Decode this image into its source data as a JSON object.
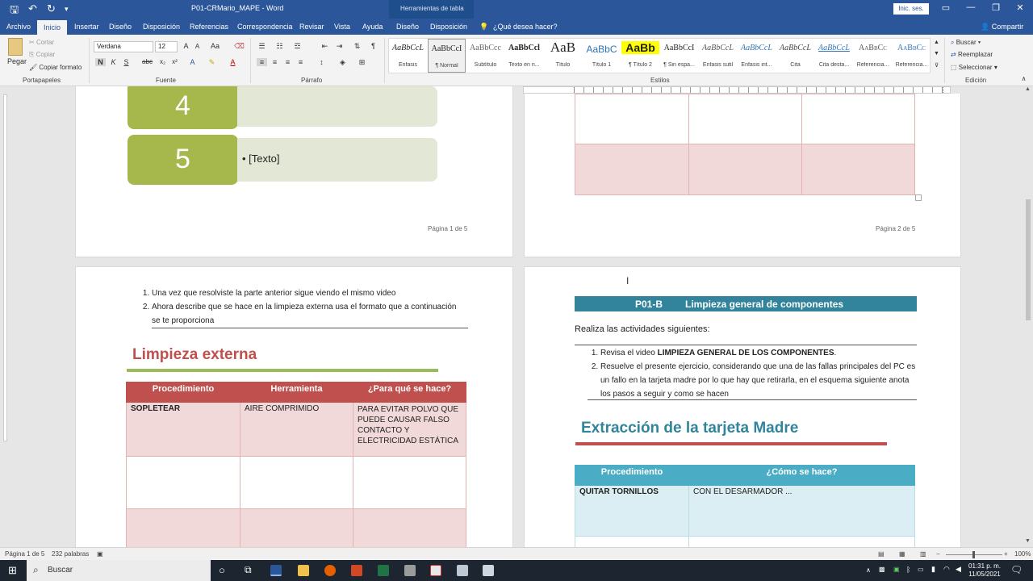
{
  "titlebar": {
    "doc_title": "P01-CRMario_MAPE  -  Word",
    "context_tools": "Herramientas de tabla",
    "login_label": "Inic. ses.",
    "share_label": "Compartir"
  },
  "tabs": [
    "Archivo",
    "Inicio",
    "Insertar",
    "Diseño",
    "Disposición",
    "Referencias",
    "Correspondencia",
    "Revisar",
    "Vista",
    "Ayuda",
    "Diseño",
    "Disposición"
  ],
  "tell_me": "¿Qué desea hacer?",
  "clipboard": {
    "paste": "Pegar",
    "cut": "Cortar",
    "copy": "Copiar",
    "format_painter": "Copiar formato",
    "group": "Portapapeles"
  },
  "font": {
    "name": "Verdana",
    "size": "12",
    "group": "Fuente"
  },
  "paragraph_group": "Párrafo",
  "styles": {
    "group": "Estilos",
    "items": [
      {
        "preview": "AaBbCcL",
        "name": "Énfasis"
      },
      {
        "preview": "AaBbCcI",
        "name": "¶ Normal"
      },
      {
        "preview": "AaBbCcc",
        "name": "Subtítulo"
      },
      {
        "preview": "AaBbCcl",
        "name": "Texto en n..."
      },
      {
        "preview": "AaB",
        "name": "Título"
      },
      {
        "preview": "AaBbC",
        "name": "Título 1"
      },
      {
        "preview": "AaBb",
        "name": "¶ Título 2"
      },
      {
        "preview": "AaBbCcI",
        "name": "¶ Sin espa..."
      },
      {
        "preview": "AaBbCcL",
        "name": "Énfasis sutil"
      },
      {
        "preview": "AaBbCcL",
        "name": "Énfasis int..."
      },
      {
        "preview": "AaBbCcL",
        "name": "Cita"
      },
      {
        "preview": "AaBbCcL",
        "name": "Cita desta..."
      },
      {
        "preview": "AaBbCc",
        "name": "Referencia..."
      },
      {
        "preview": "AaBbCc",
        "name": "Referencia..."
      }
    ]
  },
  "editing": {
    "find": "Buscar",
    "replace": "Reemplazar",
    "select": "Seleccionar",
    "group": "Edición"
  },
  "page1": {
    "box4": "4",
    "box5": "5",
    "box5_text": "• [Texto]",
    "page_label": "Página 1 de 5"
  },
  "page2": {
    "page_label": "Página 2 de 5"
  },
  "page3": {
    "list": [
      "Una vez que resolviste la parte anterior sigue viendo el mismo video",
      "Ahora describe que se hace en la limpieza externa usa el formato que a continuación se te proporciona"
    ],
    "heading": "Limpieza externa",
    "table": {
      "headers": [
        "Procedimiento",
        "Herramienta",
        "¿Para qué se hace?"
      ],
      "row1": [
        "SOPLETEAR",
        "AIRE COMPRIMIDO",
        "PARA EVITAR POLVO QUE PUEDE CAUSAR FALSO CONTACTO Y ELECTRICIDAD ESTÁTICA"
      ]
    }
  },
  "page4": {
    "banner_code": "P01-B",
    "banner_title": "Limpieza general de componentes",
    "intro": "Realiza las actividades siguientes:",
    "list1_prefix": "Revisa el video ",
    "list1_bold": "LIMPIEZA GENERAL DE LOS COMPONENTES",
    "list1_suffix": ".",
    "list2": "Resuelve el presente ejercicio, considerando que una de las fallas principales del PC es un fallo en la tarjeta madre por lo que hay que retirarla, en el esquema siguiente anota los pasos a seguir y como se hacen",
    "heading": "Extracción de la tarjeta Madre",
    "table": {
      "headers": [
        "Procedimiento",
        "¿Cómo se hace?"
      ],
      "row1": [
        "QUITAR TORNILLOS",
        "CON EL DESARMADOR ..."
      ]
    }
  },
  "status": {
    "page": "Página 1 de 5",
    "words": "232 palabras",
    "zoom": "100%"
  },
  "taskbar": {
    "search": "Buscar",
    "time": "01:31 p. m.",
    "date": "11/05/2021"
  },
  "colors": {
    "word_blue": "#2b579a",
    "olive": "#a6b84b",
    "red_header": "#c0504d",
    "teal_banner": "#31849b",
    "blue_header": "#4bacc6"
  }
}
